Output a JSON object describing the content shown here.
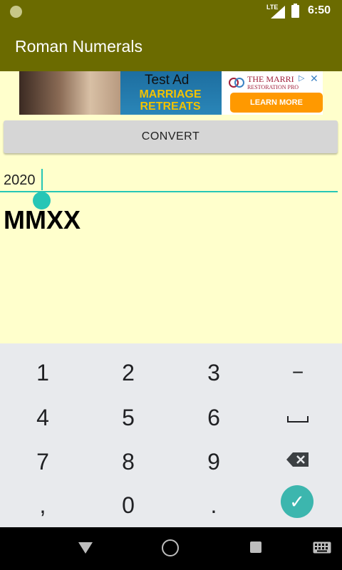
{
  "status_bar": {
    "network": "LTE",
    "time": "6:50"
  },
  "app_bar": {
    "title": "Roman Numerals"
  },
  "ad": {
    "label": "Test Ad",
    "headline_line1": "MARRIAGE",
    "headline_line2": "RETREATS",
    "brand_line1": "THE MARRI",
    "brand_line2": "RESTORATION PRO",
    "cta": "LEARN MORE"
  },
  "main": {
    "convert_button": "CONVERT",
    "input_value": "2020",
    "result": "MMXX"
  },
  "keyboard": {
    "keys": [
      "1",
      "2",
      "3",
      "−",
      "4",
      "5",
      "6",
      "␣",
      "7",
      "8",
      "9",
      "⌫",
      ",",
      "0",
      ".",
      "✓"
    ],
    "enter": "✓"
  },
  "colors": {
    "primary": "#6B6B00",
    "background": "#FFFFCC",
    "accent": "#26C6B6"
  }
}
